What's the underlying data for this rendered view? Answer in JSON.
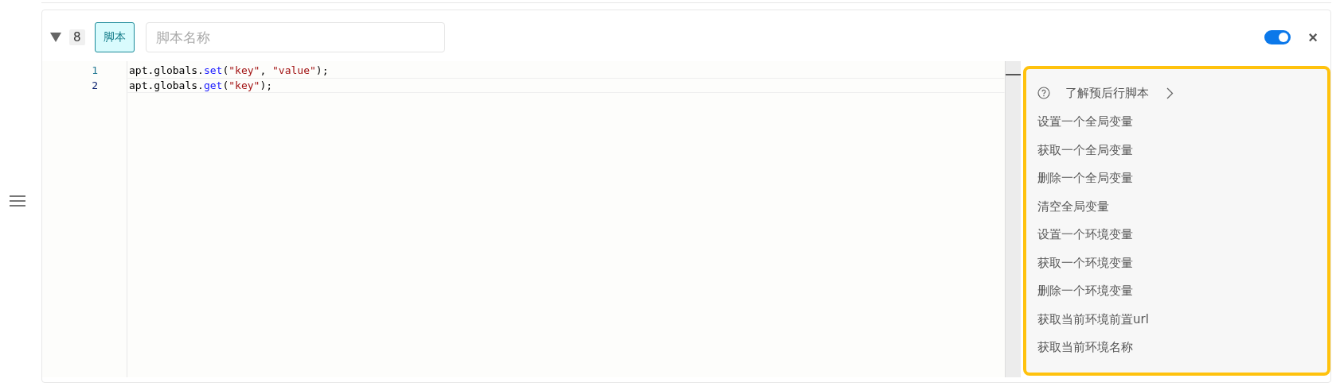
{
  "step": {
    "expanded": true,
    "index": "8",
    "tag": "脚本",
    "name_field": {
      "placeholder": "脚本名称"
    },
    "enabled": true,
    "close": "×"
  },
  "editor": {
    "lines": [
      {
        "number": "1",
        "active": false,
        "tokens": [
          {
            "kind": "plain",
            "text": "apt.globals."
          },
          {
            "kind": "method",
            "text": "set"
          },
          {
            "kind": "plain",
            "text": "("
          },
          {
            "kind": "string",
            "text": "\"key\""
          },
          {
            "kind": "plain",
            "text": ", "
          },
          {
            "kind": "string",
            "text": "\"value\""
          },
          {
            "kind": "plain",
            "text": ");"
          }
        ]
      },
      {
        "number": "2",
        "active": true,
        "tokens": [
          {
            "kind": "plain",
            "text": "apt.globals."
          },
          {
            "kind": "method",
            "text": "get"
          },
          {
            "kind": "plain",
            "text": "("
          },
          {
            "kind": "string",
            "text": "\"key\""
          },
          {
            "kind": "plain",
            "text": ");"
          }
        ]
      }
    ]
  },
  "snippets": {
    "help": {
      "label": "了解预后行脚本"
    },
    "items": [
      "设置一个全局变量",
      "获取一个全局变量",
      "删除一个全局变量",
      "清空全局变量",
      "设置一个环境变量",
      "获取一个环境变量",
      "删除一个环境变量",
      "获取当前环境前置url",
      "获取当前环境名称"
    ]
  }
}
